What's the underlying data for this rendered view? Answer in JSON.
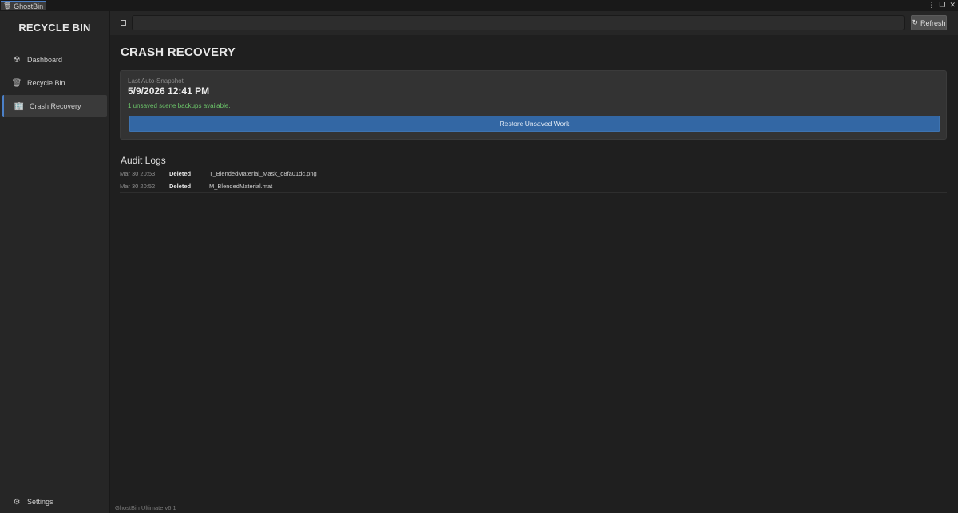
{
  "window": {
    "tab_icon": "trash-icon",
    "tab_label": "GhostBin",
    "controls": [
      "⋮",
      "❐",
      "✕"
    ]
  },
  "sidebar": {
    "title": "RECYCLE BIN",
    "items": [
      {
        "label": "Dashboard",
        "icon": "radiation-icon"
      },
      {
        "label": "Recycle Bin",
        "icon": "trash-icon"
      },
      {
        "label": "Crash Recovery",
        "icon": "building-icon",
        "active": true
      }
    ],
    "settings_label": "Settings",
    "settings_icon": "gear-icon"
  },
  "toolbar": {
    "search_value": "",
    "refresh_label": "Refresh",
    "refresh_icon": "refresh-icon"
  },
  "page": {
    "title": "CRASH RECOVERY"
  },
  "snapshot": {
    "label": "Last Auto-Snapshot",
    "time": "5/9/2026 12:41 PM",
    "status": "1 unsaved scene backups available.",
    "restore_label": "Restore Unsaved Work"
  },
  "audit": {
    "title": "Audit Logs",
    "rows": [
      {
        "time": "Mar 30 20:53",
        "action": "Deleted",
        "file": "T_BlendedMaterial_Mask_d8fa01dc.png"
      },
      {
        "time": "Mar 30 20:52",
        "action": "Deleted",
        "file": "M_BlendedMaterial.mat"
      }
    ]
  },
  "footer": {
    "version": "GhostBin Ultimate v6.1"
  },
  "colors": {
    "accent": "#4b80c8",
    "restore_button": "#3367a4",
    "status_green": "#6cc66a"
  }
}
